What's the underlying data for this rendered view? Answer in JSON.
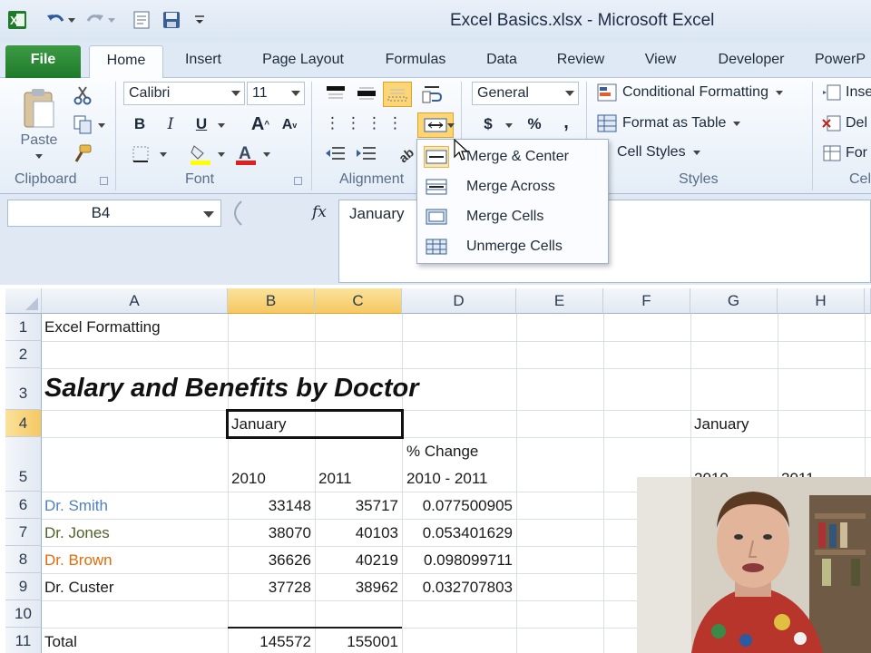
{
  "window": {
    "title": "Excel Basics.xlsx  -  Microsoft Excel"
  },
  "tabs": [
    {
      "label": "File"
    },
    {
      "label": "Home"
    },
    {
      "label": "Insert"
    },
    {
      "label": "Page Layout"
    },
    {
      "label": "Formulas"
    },
    {
      "label": "Data"
    },
    {
      "label": "Review"
    },
    {
      "label": "View"
    },
    {
      "label": "Developer"
    },
    {
      "label": "PowerP"
    }
  ],
  "ribbon": {
    "clipboard": {
      "label": "Clipboard",
      "paste": "Paste"
    },
    "font": {
      "label": "Font",
      "name": "Calibri",
      "size": "11"
    },
    "alignment": {
      "label": "Alignment"
    },
    "number": {
      "format": "General",
      "currency": "$",
      "percent": "%",
      "comma": ","
    },
    "styles": {
      "label": "Styles",
      "conditional": "Conditional Formatting",
      "table": "Format as Table",
      "cell_styles": "Cell Styles"
    },
    "cells": {
      "label": "Cel",
      "insert": "Inse",
      "delete": "Del",
      "format": "For"
    }
  },
  "formula_bar": {
    "name_box": "B4",
    "fx": "fx",
    "value": "January"
  },
  "merge_menu": {
    "items": [
      {
        "label": "Merge & Center"
      },
      {
        "label": "Merge Across"
      },
      {
        "label": "Merge Cells"
      },
      {
        "label": "Unmerge Cells"
      }
    ]
  },
  "sheet": {
    "columns": [
      "A",
      "B",
      "C",
      "D",
      "E",
      "F",
      "G",
      "H"
    ],
    "rows": [
      "1",
      "2",
      "3",
      "4",
      "5",
      "6",
      "7",
      "8",
      "9",
      "10",
      "11"
    ],
    "a1": "Excel Formatting",
    "title": "Salary and Benefits by Doctor",
    "b4": "January",
    "g4": "January",
    "d5_top": "% Change",
    "b5": "2010",
    "c5": "2011",
    "d5": "2010 - 2011",
    "g5": "2010",
    "h5": "2011",
    "doctors": [
      {
        "name": "Dr. Smith",
        "color": "#4f81bd",
        "v2010": "33148",
        "v2011": "35717",
        "change": "0.077500905"
      },
      {
        "name": "Dr. Jones",
        "color": "#4f6228",
        "v2010": "38070",
        "v2011": "40103",
        "change": "0.053401629"
      },
      {
        "name": "Dr. Brown",
        "color": "#e36c09",
        "v2010": "36626",
        "v2011": "40219",
        "change": "0.098099711"
      },
      {
        "name": "Dr. Custer",
        "color": "#1a1a1a",
        "v2010": "37728",
        "v2011": "38962",
        "change": "0.032707803"
      }
    ],
    "total_label": "Total",
    "total_2010": "145572",
    "total_2011": "155001"
  }
}
